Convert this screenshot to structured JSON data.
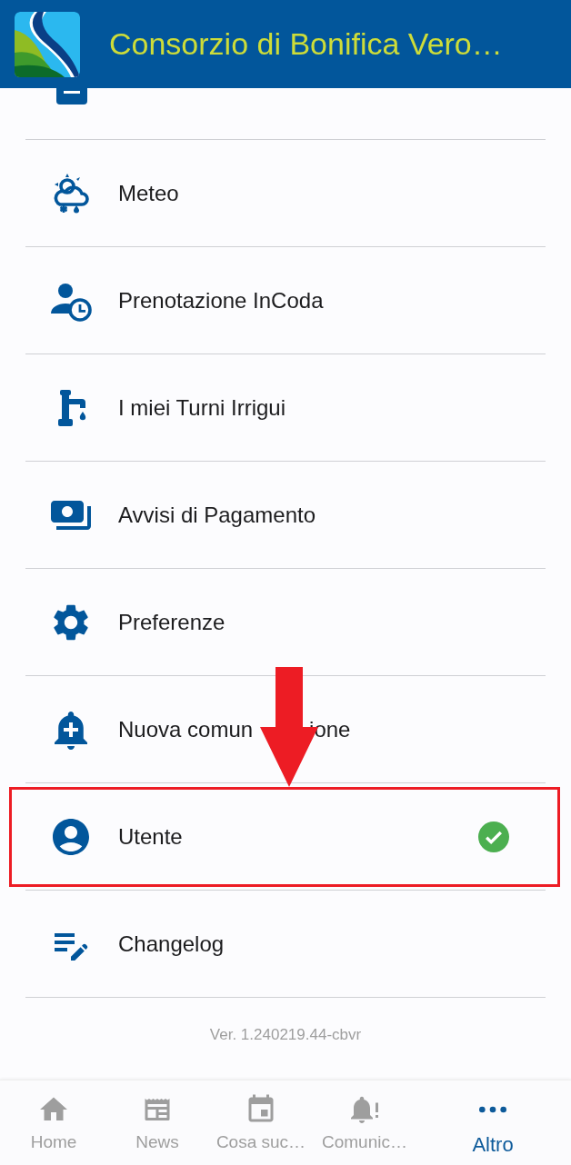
{
  "header": {
    "title": "Consorzio di Bonifica Vero…"
  },
  "menu": [
    {
      "label": "Meteo",
      "verified": false,
      "highlighted": false
    },
    {
      "label": "Prenotazione InCoda",
      "verified": false,
      "highlighted": false
    },
    {
      "label": "I miei Turni Irrigui",
      "verified": false,
      "highlighted": false
    },
    {
      "label": "Avvisi di Pagamento",
      "verified": false,
      "highlighted": false
    },
    {
      "label": "Preferenze",
      "verified": false,
      "highlighted": false
    },
    {
      "label": "Nuova comun",
      "label_end": "ione",
      "verified": false,
      "highlighted": false
    },
    {
      "label": "Utente",
      "verified": true,
      "highlighted": true
    },
    {
      "label": "Changelog",
      "verified": false,
      "highlighted": false
    }
  ],
  "version": "Ver. 1.240219.44-cbvr",
  "bottom_nav": [
    {
      "label": "Home",
      "selected": false
    },
    {
      "label": "News",
      "selected": false
    },
    {
      "label": "Cosa suc…",
      "selected": false
    },
    {
      "label": "Comunic…",
      "selected": false
    },
    {
      "label": "Altro",
      "selected": true
    }
  ]
}
